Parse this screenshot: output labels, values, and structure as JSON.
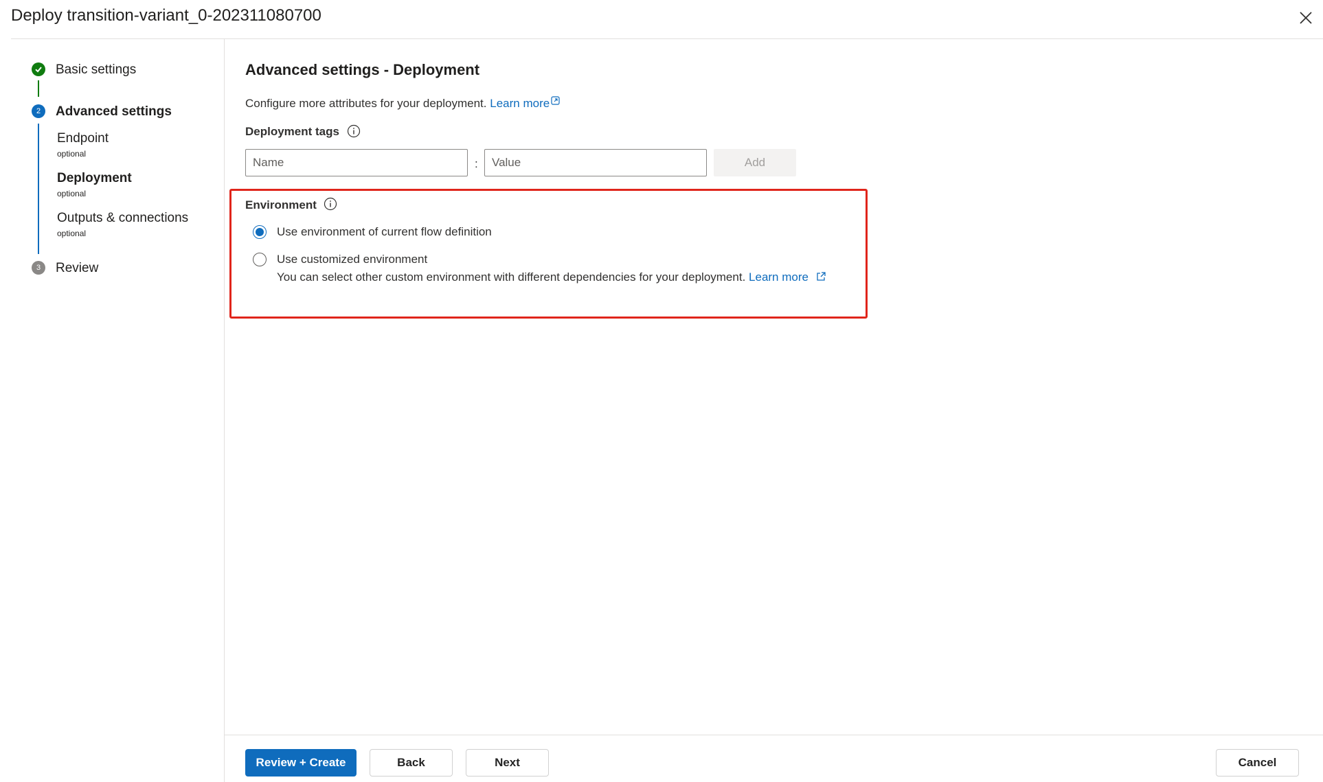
{
  "dialog": {
    "title": "Deploy transition-variant_0-202311080700"
  },
  "wizard": {
    "steps": [
      {
        "label": "Basic settings",
        "status": "completed"
      },
      {
        "label": "Advanced settings",
        "status": "current",
        "number": "2"
      },
      {
        "label": "Review",
        "status": "pending",
        "number": "3"
      }
    ],
    "substeps": [
      {
        "label": "Endpoint",
        "optional": "optional"
      },
      {
        "label": "Deployment",
        "optional": "optional"
      },
      {
        "label": "Outputs & connections",
        "optional": "optional"
      }
    ]
  },
  "main": {
    "title": "Advanced settings - Deployment",
    "description": "Configure more attributes for your deployment.",
    "description_link": "Learn more",
    "tags": {
      "label": "Deployment tags",
      "name_placeholder": "Name",
      "separator": ":",
      "value_placeholder": "Value",
      "add_label": "Add"
    },
    "environment": {
      "label": "Environment",
      "options": [
        {
          "label": "Use environment of current flow definition",
          "selected": true
        },
        {
          "label": "Use customized environment",
          "selected": false,
          "sublabel": "You can select other custom environment with different dependencies for your deployment.",
          "link": "Learn more"
        }
      ]
    }
  },
  "footer": {
    "review_create": "Review + Create",
    "back": "Back",
    "next": "Next",
    "cancel": "Cancel"
  },
  "colors": {
    "accent": "#0f6cbd",
    "success": "#107c10",
    "highlight": "#e0251b"
  }
}
